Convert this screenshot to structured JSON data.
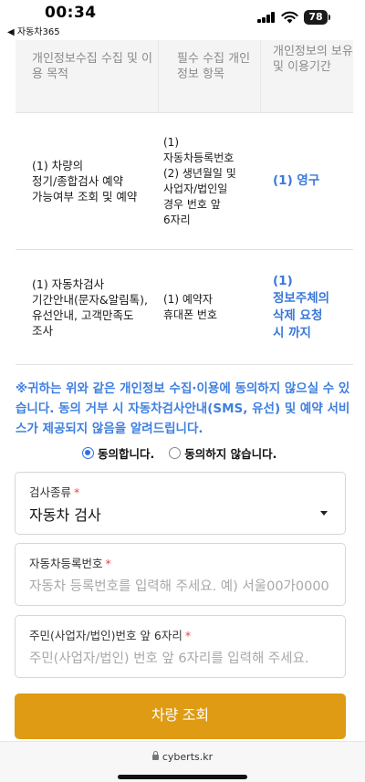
{
  "status_bar": {
    "time": "00:34",
    "back_label": "◀ 자동차365",
    "battery": "78"
  },
  "table": {
    "headers": [
      "개인정보수집 수집 및 이용 목적",
      "필수 수집 개인정보 항목",
      "개인정보의 보유 및 이용기간"
    ],
    "rows": [
      {
        "purpose_lines": [
          "(1) 차량의",
          "정기/종합검사 예약",
          "가능여부 조회 및 예약"
        ],
        "items_lines": [
          "(1)",
          "자동차등록번호",
          "(2) 생년월일 및",
          "사업자/법인일",
          "경우 번호 앞",
          "6자리"
        ],
        "period_lines": [
          "(1) 영구"
        ]
      },
      {
        "purpose_lines": [
          "(1) 자동차검사",
          "기간안내(문자&알림톡),",
          "유선안내, 고객만족도",
          "조사"
        ],
        "items_lines": [
          "(1) 예약자",
          "휴대폰 번호"
        ],
        "period_lines": [
          "(1)",
          "정보주체의",
          "삭제 요청",
          "시 까지"
        ]
      }
    ]
  },
  "notice": "※귀하는 위와 같은 개인정보 수집·이용에 동의하지 않으실 수 있습니다. 동의 거부 시 자동차검사안내(SMS, 유선) 및 예약 서비스가 제공되지 않음을 알려드립니다.",
  "consent": {
    "agree_label": "동의합니다.",
    "disagree_label": "동의하지 않습니다."
  },
  "form": {
    "inspection_type": {
      "label": "검사종류",
      "required_mark": "*",
      "value": "자동차 검사"
    },
    "registration_number": {
      "label": "자동차등록번호",
      "required_mark": "*",
      "placeholder": "자동차 등록번호를 입력해 주세요. 예) 서울00가0000"
    },
    "id_number": {
      "label": "주민(사업자/법인)번호 앞 6자리",
      "required_mark": "*",
      "placeholder": "주민(사업자/법인) 번호 앞 6자리를 입력해 주세요."
    },
    "submit_label": "차량 조회"
  },
  "footer": {
    "url": "cyberts.kr"
  },
  "colors": {
    "accent_blue": "#3a78d8",
    "submit_button": "#df9b13",
    "required": "#e0474c"
  }
}
